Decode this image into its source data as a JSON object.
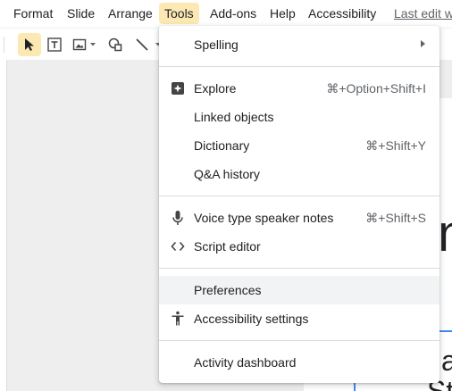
{
  "menubar": {
    "items": [
      "Format",
      "Slide",
      "Arrange",
      "Tools",
      "Add-ons",
      "Help",
      "Accessibility"
    ],
    "active": "Tools",
    "last_edit": "Last edit w"
  },
  "slide_text": {
    "big": "n",
    "mid": "a",
    "bottom": "St"
  },
  "tools_menu": {
    "items": [
      {
        "label": "Spelling",
        "shortcut": "",
        "submenu": true
      },
      {
        "label": "Explore",
        "shortcut": "⌘+Option+Shift+I",
        "icon": "explore-icon"
      },
      {
        "label": "Linked objects",
        "shortcut": ""
      },
      {
        "label": "Dictionary",
        "shortcut": "⌘+Shift+Y"
      },
      {
        "label": "Q&A history",
        "shortcut": ""
      },
      {
        "label": "Voice type speaker notes",
        "shortcut": "⌘+Shift+S",
        "icon": "microphone-icon"
      },
      {
        "label": "Script editor",
        "shortcut": "",
        "icon": "code-icon"
      },
      {
        "label": "Preferences",
        "shortcut": "",
        "hovered": true
      },
      {
        "label": "Accessibility settings",
        "shortcut": "",
        "icon": "accessibility-icon"
      },
      {
        "label": "Activity dashboard",
        "shortcut": ""
      }
    ]
  },
  "colors": {
    "active_menu_bg": "#fce8b2",
    "hover_bg": "#f1f3f4",
    "selection_blue": "#4285f4"
  }
}
